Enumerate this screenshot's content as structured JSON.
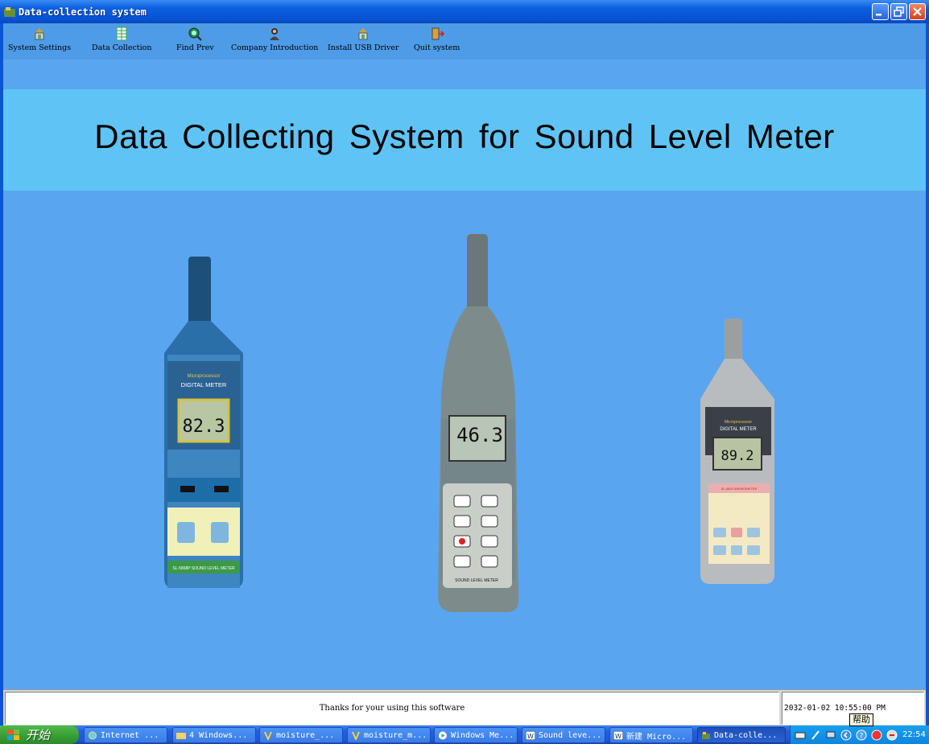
{
  "window": {
    "title": "Data-collection system",
    "controls": [
      "minimize-icon",
      "restore-icon",
      "close-icon"
    ]
  },
  "toolbar": {
    "items": [
      {
        "label": "System Settings",
        "icon": "settings-icon"
      },
      {
        "label": "Data Collection",
        "icon": "data-sheet-icon"
      },
      {
        "label": "Find Prev",
        "icon": "magnifier-icon"
      },
      {
        "label": "Company Introduction",
        "icon": "person-icon"
      },
      {
        "label": "Install USB Driver",
        "icon": "install-icon"
      },
      {
        "label": "Quit system",
        "icon": "exit-door-icon"
      }
    ]
  },
  "main": {
    "title": "Data Collecting System for Sound Level Meter",
    "meters": [
      {
        "display": "82.3",
        "brand": "DIGITAL METER",
        "name": "SL-5868P SOUND LEVEL METER"
      },
      {
        "display": "46.3",
        "name": "SOUND LEVEL METER"
      },
      {
        "display": "89.2",
        "brand": "DIGITAL METER",
        "name": "SL-5800 ANEMOMETER"
      }
    ]
  },
  "status": {
    "message": "Thanks for your using this software",
    "datetime": "2032-01-02 10:55:00 PM"
  },
  "taskbar": {
    "start_label": "开始",
    "tasks": [
      {
        "label": "Internet ...",
        "icon": "ie-icon"
      },
      {
        "label": "4 Windows...",
        "icon": "folder-icon"
      },
      {
        "label": "moisture_...",
        "icon": "app-icon"
      },
      {
        "label": "moisture_m...",
        "icon": "app-icon"
      },
      {
        "label": "Windows Me...",
        "icon": "media-player-icon"
      },
      {
        "label": "Sound leve...",
        "icon": "word-icon"
      },
      {
        "label": "新建 Micro...",
        "icon": "word-icon"
      },
      {
        "label": "Data-colle...",
        "icon": "app-icon",
        "active": true
      }
    ],
    "clock": "22:54",
    "tooltip": "帮助"
  },
  "colors": {
    "client_bg": "#5aa5ef",
    "header_band": "#5fc4f5",
    "titlebar": "#0b5fe0"
  }
}
